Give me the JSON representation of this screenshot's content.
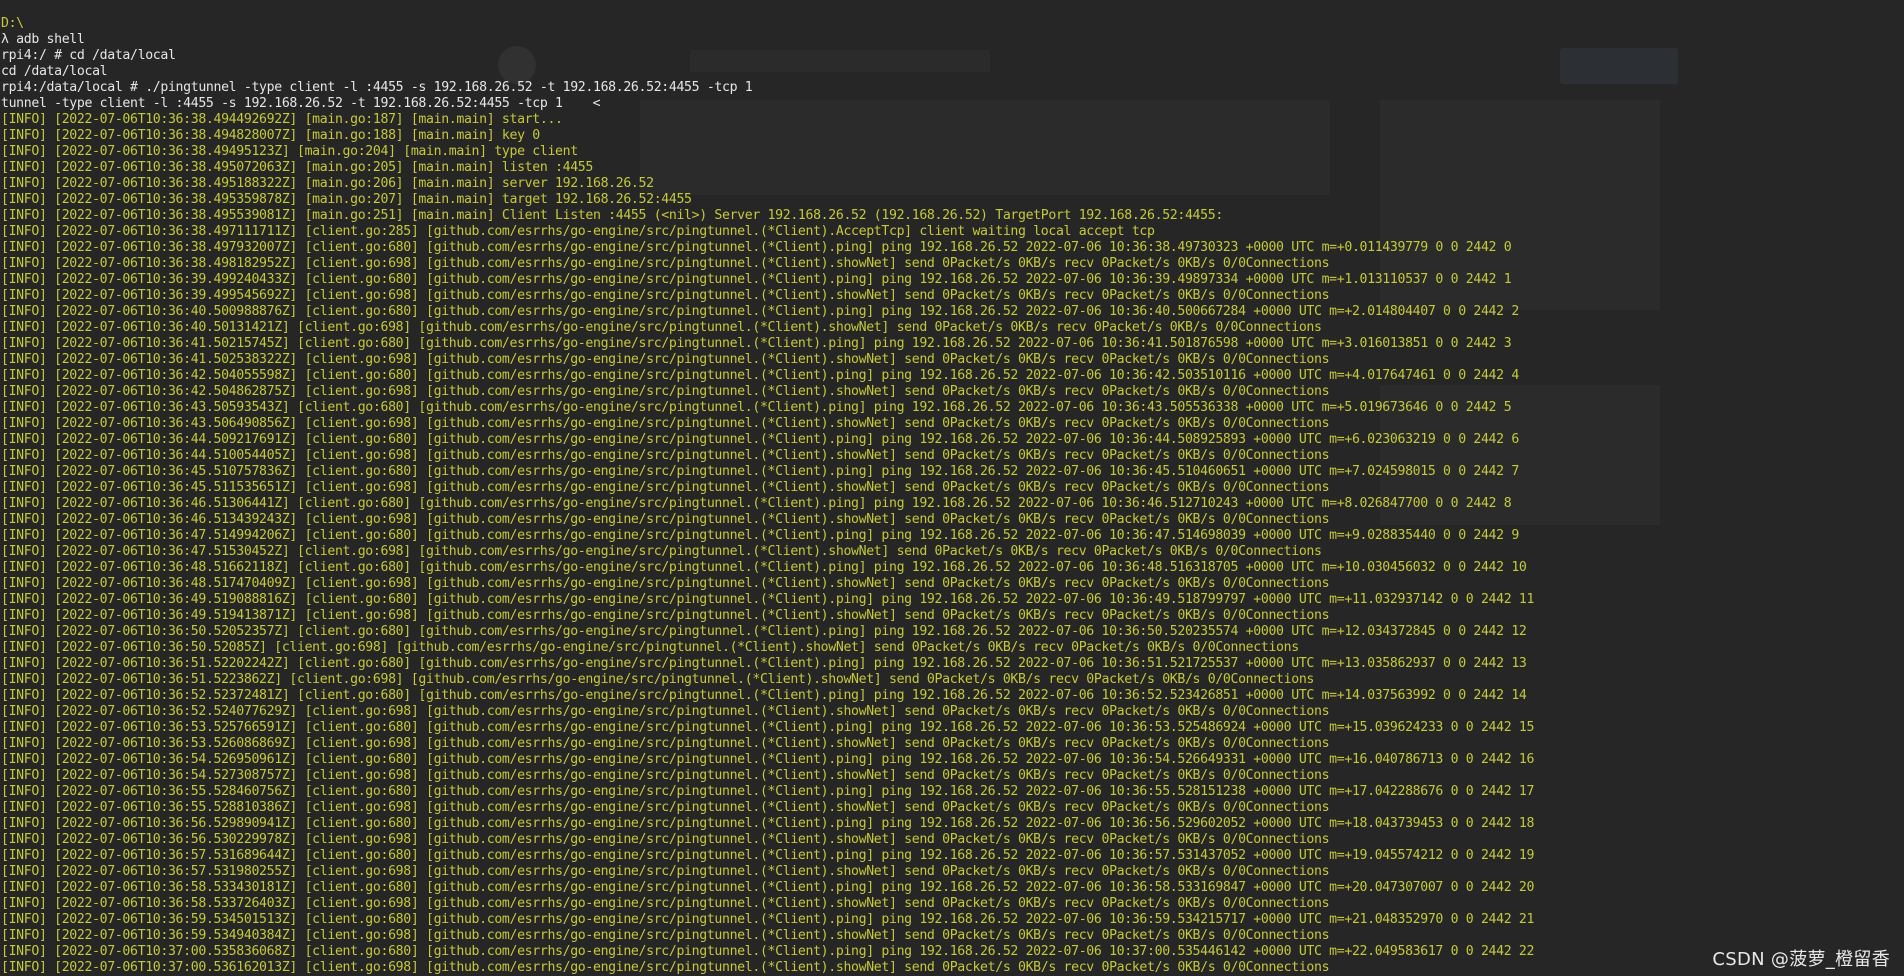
{
  "terminal": {
    "cursor_glyph": "<",
    "lines": [
      {
        "kind": "path",
        "text": "D:\\"
      },
      {
        "kind": "cmd",
        "text": "λ adb shell"
      },
      {
        "kind": "cmd",
        "text": "rpi4:/ # cd /data/local"
      },
      {
        "kind": "cmd",
        "text": "cd /data/local"
      },
      {
        "kind": "cmd",
        "text": "rpi4:/data/local # ./pingtunnel -type client -l :4455 -s 192.168.26.52 -t 192.168.26.52:4455 -tcp 1"
      },
      {
        "kind": "cursor",
        "text": "tunnel -type client -l :4455 -s 192.168.26.52 -t 192.168.26.52:4455 -tcp 1"
      },
      {
        "kind": "info",
        "text": "[INFO] [2022-07-06T10:36:38.494492692Z] [main.go:187] [main.main] start..."
      },
      {
        "kind": "info",
        "text": "[INFO] [2022-07-06T10:36:38.494828007Z] [main.go:188] [main.main] key 0"
      },
      {
        "kind": "info",
        "text": "[INFO] [2022-07-06T10:36:38.49495123Z] [main.go:204] [main.main] type client"
      },
      {
        "kind": "info",
        "text": "[INFO] [2022-07-06T10:36:38.495072063Z] [main.go:205] [main.main] listen :4455"
      },
      {
        "kind": "info",
        "text": "[INFO] [2022-07-06T10:36:38.495188322Z] [main.go:206] [main.main] server 192.168.26.52"
      },
      {
        "kind": "info",
        "text": "[INFO] [2022-07-06T10:36:38.495359878Z] [main.go:207] [main.main] target 192.168.26.52:4455"
      },
      {
        "kind": "info",
        "text": "[INFO] [2022-07-06T10:36:38.495539081Z] [main.go:251] [main.main] Client Listen :4455 (<nil>) Server 192.168.26.52 (192.168.26.52) TargetPort 192.168.26.52:4455:"
      },
      {
        "kind": "info",
        "text": "[INFO] [2022-07-06T10:36:38.497111711Z] [client.go:285] [github.com/esrrhs/go-engine/src/pingtunnel.(*Client).AcceptTcp] client waiting local accept tcp"
      },
      {
        "kind": "info",
        "text": "[INFO] [2022-07-06T10:36:38.497932007Z] [client.go:680] [github.com/esrrhs/go-engine/src/pingtunnel.(*Client).ping] ping 192.168.26.52 2022-07-06 10:36:38.49730323 +0000 UTC m=+0.011439779 0 0 2442 0"
      },
      {
        "kind": "info",
        "text": "[INFO] [2022-07-06T10:36:38.498182952Z] [client.go:698] [github.com/esrrhs/go-engine/src/pingtunnel.(*Client).showNet] send 0Packet/s 0KB/s recv 0Packet/s 0KB/s 0/0Connections"
      },
      {
        "kind": "info",
        "text": "[INFO] [2022-07-06T10:36:39.499240433Z] [client.go:680] [github.com/esrrhs/go-engine/src/pingtunnel.(*Client).ping] ping 192.168.26.52 2022-07-06 10:36:39.49897334 +0000 UTC m=+1.013110537 0 0 2442 1"
      },
      {
        "kind": "info",
        "text": "[INFO] [2022-07-06T10:36:39.499545692Z] [client.go:698] [github.com/esrrhs/go-engine/src/pingtunnel.(*Client).showNet] send 0Packet/s 0KB/s recv 0Packet/s 0KB/s 0/0Connections"
      },
      {
        "kind": "info",
        "text": "[INFO] [2022-07-06T10:36:40.500988876Z] [client.go:680] [github.com/esrrhs/go-engine/src/pingtunnel.(*Client).ping] ping 192.168.26.52 2022-07-06 10:36:40.500667284 +0000 UTC m=+2.014804407 0 0 2442 2"
      },
      {
        "kind": "info",
        "text": "[INFO] [2022-07-06T10:36:40.50131421Z] [client.go:698] [github.com/esrrhs/go-engine/src/pingtunnel.(*Client).showNet] send 0Packet/s 0KB/s recv 0Packet/s 0KB/s 0/0Connections"
      },
      {
        "kind": "info",
        "text": "[INFO] [2022-07-06T10:36:41.50215745Z] [client.go:680] [github.com/esrrhs/go-engine/src/pingtunnel.(*Client).ping] ping 192.168.26.52 2022-07-06 10:36:41.501876598 +0000 UTC m=+3.016013851 0 0 2442 3"
      },
      {
        "kind": "info",
        "text": "[INFO] [2022-07-06T10:36:41.502538322Z] [client.go:698] [github.com/esrrhs/go-engine/src/pingtunnel.(*Client).showNet] send 0Packet/s 0KB/s recv 0Packet/s 0KB/s 0/0Connections"
      },
      {
        "kind": "info",
        "text": "[INFO] [2022-07-06T10:36:42.504055598Z] [client.go:680] [github.com/esrrhs/go-engine/src/pingtunnel.(*Client).ping] ping 192.168.26.52 2022-07-06 10:36:42.503510116 +0000 UTC m=+4.017647461 0 0 2442 4"
      },
      {
        "kind": "info",
        "text": "[INFO] [2022-07-06T10:36:42.504862875Z] [client.go:698] [github.com/esrrhs/go-engine/src/pingtunnel.(*Client).showNet] send 0Packet/s 0KB/s recv 0Packet/s 0KB/s 0/0Connections"
      },
      {
        "kind": "info",
        "text": "[INFO] [2022-07-06T10:36:43.50593543Z] [client.go:680] [github.com/esrrhs/go-engine/src/pingtunnel.(*Client).ping] ping 192.168.26.52 2022-07-06 10:36:43.505536338 +0000 UTC m=+5.019673646 0 0 2442 5"
      },
      {
        "kind": "info",
        "text": "[INFO] [2022-07-06T10:36:43.506490856Z] [client.go:698] [github.com/esrrhs/go-engine/src/pingtunnel.(*Client).showNet] send 0Packet/s 0KB/s recv 0Packet/s 0KB/s 0/0Connections"
      },
      {
        "kind": "info",
        "text": "[INFO] [2022-07-06T10:36:44.509217691Z] [client.go:680] [github.com/esrrhs/go-engine/src/pingtunnel.(*Client).ping] ping 192.168.26.52 2022-07-06 10:36:44.508925893 +0000 UTC m=+6.023063219 0 0 2442 6"
      },
      {
        "kind": "info",
        "text": "[INFO] [2022-07-06T10:36:44.510054405Z] [client.go:698] [github.com/esrrhs/go-engine/src/pingtunnel.(*Client).showNet] send 0Packet/s 0KB/s recv 0Packet/s 0KB/s 0/0Connections"
      },
      {
        "kind": "info",
        "text": "[INFO] [2022-07-06T10:36:45.510757836Z] [client.go:680] [github.com/esrrhs/go-engine/src/pingtunnel.(*Client).ping] ping 192.168.26.52 2022-07-06 10:36:45.510460651 +0000 UTC m=+7.024598015 0 0 2442 7"
      },
      {
        "kind": "info",
        "text": "[INFO] [2022-07-06T10:36:45.511535651Z] [client.go:698] [github.com/esrrhs/go-engine/src/pingtunnel.(*Client).showNet] send 0Packet/s 0KB/s recv 0Packet/s 0KB/s 0/0Connections"
      },
      {
        "kind": "info",
        "text": "[INFO] [2022-07-06T10:36:46.51306441Z] [client.go:680] [github.com/esrrhs/go-engine/src/pingtunnel.(*Client).ping] ping 192.168.26.52 2022-07-06 10:36:46.512710243 +0000 UTC m=+8.026847700 0 0 2442 8"
      },
      {
        "kind": "info",
        "text": "[INFO] [2022-07-06T10:36:46.513439243Z] [client.go:698] [github.com/esrrhs/go-engine/src/pingtunnel.(*Client).showNet] send 0Packet/s 0KB/s recv 0Packet/s 0KB/s 0/0Connections"
      },
      {
        "kind": "info",
        "text": "[INFO] [2022-07-06T10:36:47.514994206Z] [client.go:680] [github.com/esrrhs/go-engine/src/pingtunnel.(*Client).ping] ping 192.168.26.52 2022-07-06 10:36:47.514698039 +0000 UTC m=+9.028835440 0 0 2442 9"
      },
      {
        "kind": "info",
        "text": "[INFO] [2022-07-06T10:36:47.51530452Z] [client.go:698] [github.com/esrrhs/go-engine/src/pingtunnel.(*Client).showNet] send 0Packet/s 0KB/s recv 0Packet/s 0KB/s 0/0Connections"
      },
      {
        "kind": "info",
        "text": "[INFO] [2022-07-06T10:36:48.51662118Z] [client.go:680] [github.com/esrrhs/go-engine/src/pingtunnel.(*Client).ping] ping 192.168.26.52 2022-07-06 10:36:48.516318705 +0000 UTC m=+10.030456032 0 0 2442 10"
      },
      {
        "kind": "info",
        "text": "[INFO] [2022-07-06T10:36:48.517470409Z] [client.go:698] [github.com/esrrhs/go-engine/src/pingtunnel.(*Client).showNet] send 0Packet/s 0KB/s recv 0Packet/s 0KB/s 0/0Connections"
      },
      {
        "kind": "info",
        "text": "[INFO] [2022-07-06T10:36:49.519088816Z] [client.go:680] [github.com/esrrhs/go-engine/src/pingtunnel.(*Client).ping] ping 192.168.26.52 2022-07-06 10:36:49.518799797 +0000 UTC m=+11.032937142 0 0 2442 11"
      },
      {
        "kind": "info",
        "text": "[INFO] [2022-07-06T10:36:49.519413871Z] [client.go:698] [github.com/esrrhs/go-engine/src/pingtunnel.(*Client).showNet] send 0Packet/s 0KB/s recv 0Packet/s 0KB/s 0/0Connections"
      },
      {
        "kind": "info",
        "text": "[INFO] [2022-07-06T10:36:50.52052357Z] [client.go:680] [github.com/esrrhs/go-engine/src/pingtunnel.(*Client).ping] ping 192.168.26.52 2022-07-06 10:36:50.520235574 +0000 UTC m=+12.034372845 0 0 2442 12"
      },
      {
        "kind": "info",
        "text": "[INFO] [2022-07-06T10:36:50.52085Z] [client.go:698] [github.com/esrrhs/go-engine/src/pingtunnel.(*Client).showNet] send 0Packet/s 0KB/s recv 0Packet/s 0KB/s 0/0Connections"
      },
      {
        "kind": "info",
        "text": "[INFO] [2022-07-06T10:36:51.52202242Z] [client.go:680] [github.com/esrrhs/go-engine/src/pingtunnel.(*Client).ping] ping 192.168.26.52 2022-07-06 10:36:51.521725537 +0000 UTC m=+13.035862937 0 0 2442 13"
      },
      {
        "kind": "info",
        "text": "[INFO] [2022-07-06T10:36:51.5223862Z] [client.go:698] [github.com/esrrhs/go-engine/src/pingtunnel.(*Client).showNet] send 0Packet/s 0KB/s recv 0Packet/s 0KB/s 0/0Connections"
      },
      {
        "kind": "info",
        "text": "[INFO] [2022-07-06T10:36:52.52372481Z] [client.go:680] [github.com/esrrhs/go-engine/src/pingtunnel.(*Client).ping] ping 192.168.26.52 2022-07-06 10:36:52.523426851 +0000 UTC m=+14.037563992 0 0 2442 14"
      },
      {
        "kind": "info",
        "text": "[INFO] [2022-07-06T10:36:52.524077629Z] [client.go:698] [github.com/esrrhs/go-engine/src/pingtunnel.(*Client).showNet] send 0Packet/s 0KB/s recv 0Packet/s 0KB/s 0/0Connections"
      },
      {
        "kind": "info",
        "text": "[INFO] [2022-07-06T10:36:53.525766591Z] [client.go:680] [github.com/esrrhs/go-engine/src/pingtunnel.(*Client).ping] ping 192.168.26.52 2022-07-06 10:36:53.525486924 +0000 UTC m=+15.039624233 0 0 2442 15"
      },
      {
        "kind": "info",
        "text": "[INFO] [2022-07-06T10:36:53.526086869Z] [client.go:698] [github.com/esrrhs/go-engine/src/pingtunnel.(*Client).showNet] send 0Packet/s 0KB/s recv 0Packet/s 0KB/s 0/0Connections"
      },
      {
        "kind": "info",
        "text": "[INFO] [2022-07-06T10:36:54.526950961Z] [client.go:680] [github.com/esrrhs/go-engine/src/pingtunnel.(*Client).ping] ping 192.168.26.52 2022-07-06 10:36:54.526649331 +0000 UTC m=+16.040786713 0 0 2442 16"
      },
      {
        "kind": "info",
        "text": "[INFO] [2022-07-06T10:36:54.527308757Z] [client.go:698] [github.com/esrrhs/go-engine/src/pingtunnel.(*Client).showNet] send 0Packet/s 0KB/s recv 0Packet/s 0KB/s 0/0Connections"
      },
      {
        "kind": "info",
        "text": "[INFO] [2022-07-06T10:36:55.528460756Z] [client.go:680] [github.com/esrrhs/go-engine/src/pingtunnel.(*Client).ping] ping 192.168.26.52 2022-07-06 10:36:55.528151238 +0000 UTC m=+17.042288676 0 0 2442 17"
      },
      {
        "kind": "info",
        "text": "[INFO] [2022-07-06T10:36:55.528810386Z] [client.go:698] [github.com/esrrhs/go-engine/src/pingtunnel.(*Client).showNet] send 0Packet/s 0KB/s recv 0Packet/s 0KB/s 0/0Connections"
      },
      {
        "kind": "info",
        "text": "[INFO] [2022-07-06T10:36:56.529890941Z] [client.go:680] [github.com/esrrhs/go-engine/src/pingtunnel.(*Client).ping] ping 192.168.26.52 2022-07-06 10:36:56.529602052 +0000 UTC m=+18.043739453 0 0 2442 18"
      },
      {
        "kind": "info",
        "text": "[INFO] [2022-07-06T10:36:56.530229978Z] [client.go:698] [github.com/esrrhs/go-engine/src/pingtunnel.(*Client).showNet] send 0Packet/s 0KB/s recv 0Packet/s 0KB/s 0/0Connections"
      },
      {
        "kind": "info",
        "text": "[INFO] [2022-07-06T10:36:57.531689644Z] [client.go:680] [github.com/esrrhs/go-engine/src/pingtunnel.(*Client).ping] ping 192.168.26.52 2022-07-06 10:36:57.531437052 +0000 UTC m=+19.045574212 0 0 2442 19"
      },
      {
        "kind": "info",
        "text": "[INFO] [2022-07-06T10:36:57.531980255Z] [client.go:698] [github.com/esrrhs/go-engine/src/pingtunnel.(*Client).showNet] send 0Packet/s 0KB/s recv 0Packet/s 0KB/s 0/0Connections"
      },
      {
        "kind": "info",
        "text": "[INFO] [2022-07-06T10:36:58.533430181Z] [client.go:680] [github.com/esrrhs/go-engine/src/pingtunnel.(*Client).ping] ping 192.168.26.52 2022-07-06 10:36:58.533169847 +0000 UTC m=+20.047307007 0 0 2442 20"
      },
      {
        "kind": "info",
        "text": "[INFO] [2022-07-06T10:36:58.533726403Z] [client.go:698] [github.com/esrrhs/go-engine/src/pingtunnel.(*Client).showNet] send 0Packet/s 0KB/s recv 0Packet/s 0KB/s 0/0Connections"
      },
      {
        "kind": "info",
        "text": "[INFO] [2022-07-06T10:36:59.534501513Z] [client.go:680] [github.com/esrrhs/go-engine/src/pingtunnel.(*Client).ping] ping 192.168.26.52 2022-07-06 10:36:59.534215717 +0000 UTC m=+21.048352970 0 0 2442 21"
      },
      {
        "kind": "info",
        "text": "[INFO] [2022-07-06T10:36:59.534940384Z] [client.go:698] [github.com/esrrhs/go-engine/src/pingtunnel.(*Client).showNet] send 0Packet/s 0KB/s recv 0Packet/s 0KB/s 0/0Connections"
      },
      {
        "kind": "info",
        "text": "[INFO] [2022-07-06T10:37:00.535836068Z] [client.go:680] [github.com/esrrhs/go-engine/src/pingtunnel.(*Client).ping] ping 192.168.26.52 2022-07-06 10:37:00.535446142 +0000 UTC m=+22.049583617 0 0 2442 22"
      },
      {
        "kind": "info",
        "text": "[INFO] [2022-07-06T10:37:00.536162013Z] [client.go:698] [github.com/esrrhs/go-engine/src/pingtunnel.(*Client).showNet] send 0Packet/s 0KB/s recv 0Packet/s 0KB/s 0/0Connections"
      }
    ]
  },
  "watermark": {
    "text": "CSDN @菠萝_橙留香"
  },
  "colors": {
    "background": "#262626",
    "log_text": "#c5c93a",
    "command_text": "#e6e6e6"
  }
}
